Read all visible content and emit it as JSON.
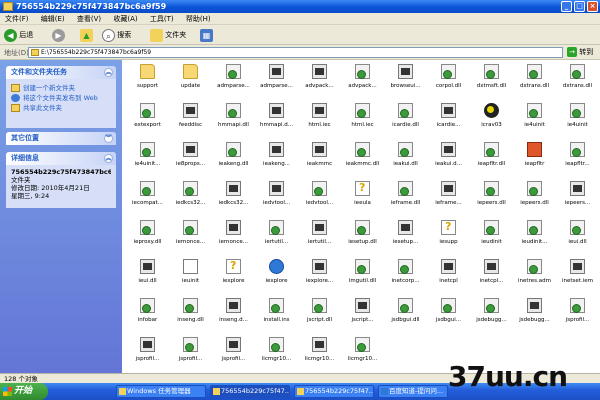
{
  "window": {
    "title": "756554b229c75f473847bc6a9f59",
    "minimize": "_",
    "maximize": "□",
    "close": "×"
  },
  "menu": [
    "文件(F)",
    "编辑(E)",
    "查看(V)",
    "收藏(A)",
    "工具(T)",
    "帮助(H)"
  ],
  "toolbar": {
    "back": "后退",
    "search": "搜索",
    "folders": "文件夹"
  },
  "address": {
    "label": "地址(D)",
    "value": "E:\\756554b229c75f473847bc6a9f59",
    "go": "转到"
  },
  "tasks_panel": {
    "title": "文件和文件夹任务",
    "items": [
      "创建一个新文件夹",
      "将这个文件夹发布到 Web",
      "共享此文件夹"
    ]
  },
  "other_panel": {
    "title": "其它位置"
  },
  "details_panel": {
    "title": "详细信息",
    "name": "756554b229c75f473847bc6f",
    "type": "文件夹",
    "modified": "修改日期: 2010年4月21日",
    "time": "星期三, 9:24"
  },
  "files": [
    {
      "name": "support",
      "icon": "folder"
    },
    {
      "name": "update",
      "icon": "folder"
    },
    {
      "name": "admparse...",
      "icon": "dll"
    },
    {
      "name": "admparse...",
      "icon": "sys"
    },
    {
      "name": "advpack...",
      "icon": "sys"
    },
    {
      "name": "advpack...",
      "icon": "dll"
    },
    {
      "name": "browseui...",
      "icon": "sys"
    },
    {
      "name": "corpol.dll",
      "icon": "dll"
    },
    {
      "name": "dxtmsft.dll",
      "icon": "dll"
    },
    {
      "name": "dxtrans.dll",
      "icon": "dll"
    },
    {
      "name": "dxtrans.dll",
      "icon": "dll"
    },
    {
      "name": "extexport",
      "icon": "dll"
    },
    {
      "name": "feeddisc",
      "icon": "sys"
    },
    {
      "name": "hmmapi.dll",
      "icon": "dll"
    },
    {
      "name": "hmmapi.d...",
      "icon": "sys"
    },
    {
      "name": "html.iec",
      "icon": "sys"
    },
    {
      "name": "html.iec",
      "icon": "dll"
    },
    {
      "name": "icardie.dll",
      "icon": "dll"
    },
    {
      "name": "icardie...",
      "icon": "sys"
    },
    {
      "name": "icrav03",
      "icon": "gear"
    },
    {
      "name": "ie4uinit",
      "icon": "dll"
    },
    {
      "name": "ie4uinit",
      "icon": "dll"
    },
    {
      "name": "ie4uinit...",
      "icon": "dll"
    },
    {
      "name": "ie8props...",
      "icon": "sys"
    },
    {
      "name": "ieakeng.dll",
      "icon": "dll"
    },
    {
      "name": "ieakeng...",
      "icon": "sys"
    },
    {
      "name": "ieakmmc",
      "icon": "sys"
    },
    {
      "name": "ieakmmc.dll",
      "icon": "dll"
    },
    {
      "name": "ieakui.dll",
      "icon": "dll"
    },
    {
      "name": "ieakui.d...",
      "icon": "sys"
    },
    {
      "name": "ieapfltr.dll",
      "icon": "dll"
    },
    {
      "name": "ieapfltr",
      "icon": "red"
    },
    {
      "name": "ieapfltr...",
      "icon": "dll"
    },
    {
      "name": "iecompat...",
      "icon": "dll"
    },
    {
      "name": "iedkcs32...",
      "icon": "dll"
    },
    {
      "name": "iedkcs32...",
      "icon": "sys"
    },
    {
      "name": "iedvtool...",
      "icon": "sys"
    },
    {
      "name": "iedvtool...",
      "icon": "dll"
    },
    {
      "name": "ieeula",
      "icon": "help"
    },
    {
      "name": "ieframe.dll",
      "icon": "dll"
    },
    {
      "name": "ieframe...",
      "icon": "sys"
    },
    {
      "name": "iepeers.dll",
      "icon": "dll"
    },
    {
      "name": "iepeers.dll",
      "icon": "dll"
    },
    {
      "name": "iepeers...",
      "icon": "sys"
    },
    {
      "name": "ieproxy.dll",
      "icon": "dll"
    },
    {
      "name": "iernonce...",
      "icon": "dll"
    },
    {
      "name": "iernonce...",
      "icon": "sys"
    },
    {
      "name": "iertutil...",
      "icon": "dll"
    },
    {
      "name": "iertutil...",
      "icon": "sys"
    },
    {
      "name": "iesetup.dll",
      "icon": "dll"
    },
    {
      "name": "iesetup...",
      "icon": "sys"
    },
    {
      "name": "iesupp",
      "icon": "help"
    },
    {
      "name": "ieudinit",
      "icon": "dll"
    },
    {
      "name": "ieudinit...",
      "icon": "dll"
    },
    {
      "name": "ieui.dll",
      "icon": "dll"
    },
    {
      "name": "ieui.dll",
      "icon": "sys"
    },
    {
      "name": "ieuinit",
      "icon": "doc"
    },
    {
      "name": "iexplore",
      "icon": "help"
    },
    {
      "name": "iexplore",
      "icon": "ie"
    },
    {
      "name": "iexplore...",
      "icon": "sys"
    },
    {
      "name": "imgutil.dll",
      "icon": "dll"
    },
    {
      "name": "inetcorp...",
      "icon": "dll"
    },
    {
      "name": "inetcpl",
      "icon": "sys"
    },
    {
      "name": "inetcpl...",
      "icon": "sys"
    },
    {
      "name": "inetres.adm",
      "icon": "dll"
    },
    {
      "name": "inetset.iem",
      "icon": "sys"
    },
    {
      "name": "infobar",
      "icon": "dll"
    },
    {
      "name": "inseng.dll",
      "icon": "dll"
    },
    {
      "name": "inseng.d...",
      "icon": "sys"
    },
    {
      "name": "install.ins",
      "icon": "dll"
    },
    {
      "name": "jscript.dll",
      "icon": "dll"
    },
    {
      "name": "jscript...",
      "icon": "sys"
    },
    {
      "name": "jsdbgui.dll",
      "icon": "dll"
    },
    {
      "name": "jsdbgui...",
      "icon": "dll"
    },
    {
      "name": "jsdebugg...",
      "icon": "dll"
    },
    {
      "name": "jsdebugg...",
      "icon": "sys"
    },
    {
      "name": "jsprofil...",
      "icon": "dll"
    },
    {
      "name": "jsprofil...",
      "icon": "sys"
    },
    {
      "name": "jsprofil...",
      "icon": "dll"
    },
    {
      "name": "jsprofil...",
      "icon": "sys"
    },
    {
      "name": "licmgr10...",
      "icon": "dll"
    },
    {
      "name": "licmgr10...",
      "icon": "sys"
    },
    {
      "name": "licmgr10...",
      "icon": "dll"
    }
  ],
  "status": {
    "count": "128 个对象"
  },
  "taskbar": {
    "start": "开始",
    "buttons": [
      "Windows 任务管理器",
      "756554b229c75f47...",
      "756554b229c75f47...",
      "百度知道-提问问..."
    ]
  },
  "watermark": "37uu.cn"
}
